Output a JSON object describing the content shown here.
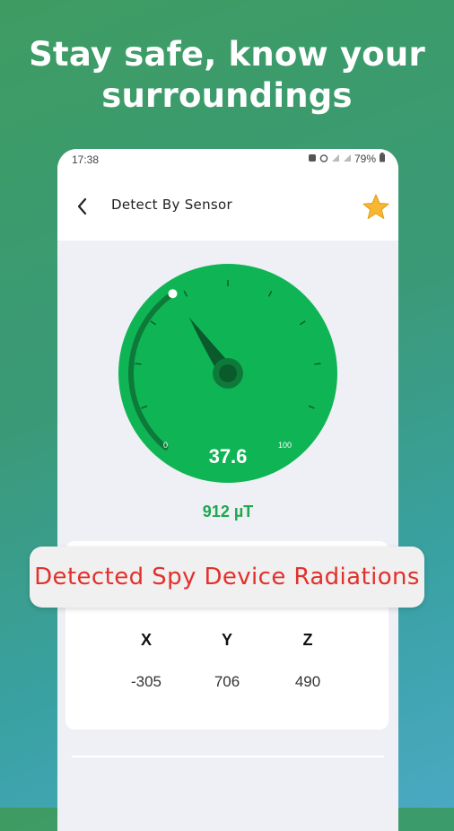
{
  "headline": {
    "line1": "Stay safe, know your",
    "line2": "surroundings"
  },
  "status_bar": {
    "time": "17:38",
    "battery": "79%",
    "icons": [
      "notification-icon",
      "alarm-icon",
      "signal-icon",
      "signal-icon",
      "battery-icon"
    ]
  },
  "app_bar": {
    "title": "Detect By Sensor",
    "back_icon": "chevron-left-icon",
    "favorite_icon": "star-icon"
  },
  "gauge": {
    "reading": "37.6",
    "min_label": "0",
    "max_label": "100",
    "min": 0,
    "max": 100,
    "value": 37.6,
    "colors": {
      "dial": "#0fb554",
      "dial_dark": "#0d7a3a",
      "needle": "#0a5a2c"
    }
  },
  "magnetic_value": "912 µT",
  "axes": [
    {
      "label": "X",
      "value": "-305"
    },
    {
      "label": "Y",
      "value": "706"
    },
    {
      "label": "Z",
      "value": "490"
    }
  ],
  "banner": {
    "text": "Detected Spy Device Radiations",
    "color": "#e3302b"
  }
}
